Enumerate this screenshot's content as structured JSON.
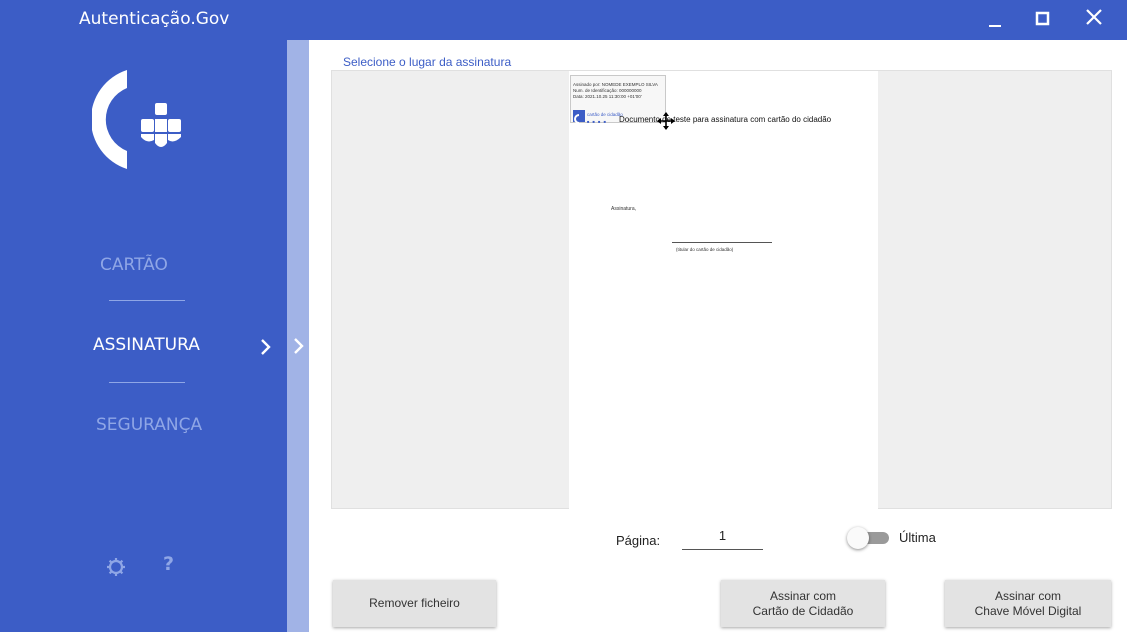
{
  "window": {
    "title": "Autenticação.Gov"
  },
  "sidebar": {
    "items": [
      {
        "label": "CARTÃO"
      },
      {
        "label": "ASSINATURA"
      },
      {
        "label": "SEGURANÇA"
      }
    ],
    "settings_icon": "gear-icon",
    "help_glyph": "?"
  },
  "main": {
    "title": "Selecione o lugar da assinatura",
    "document": {
      "signature_preview_line1": "Assinado por: NOMEDE EXEMPLO SILVA",
      "signature_preview_line2": "Num. de Identificação: 000000000",
      "signature_preview_line3": "Data: 2021.10.25 11:30:00 +01'00'",
      "signature_preview_logo_text": "cartão de cidadão",
      "heading": "Documento de teste para assinatura com cartão do cidadão",
      "signature_label": "Assinatura,",
      "signer_caption": "(titular do cartão de cidadão)"
    },
    "page_label": "Página:",
    "page_value": "1",
    "last_page_label": "Última",
    "buttons": {
      "remove": "Remover ficheiro",
      "sign_cc_line1": "Assinar com",
      "sign_cc_line2": "Cartão de Cidadão",
      "sign_cmd_line1": "Assinar com",
      "sign_cmd_line2": "Chave Móvel Digital"
    }
  },
  "colors": {
    "accent": "#3c5dc6",
    "stripe": "#a1b3e6",
    "nav_active": "#ffffff",
    "nav_inactive": "#8fa6e6"
  }
}
